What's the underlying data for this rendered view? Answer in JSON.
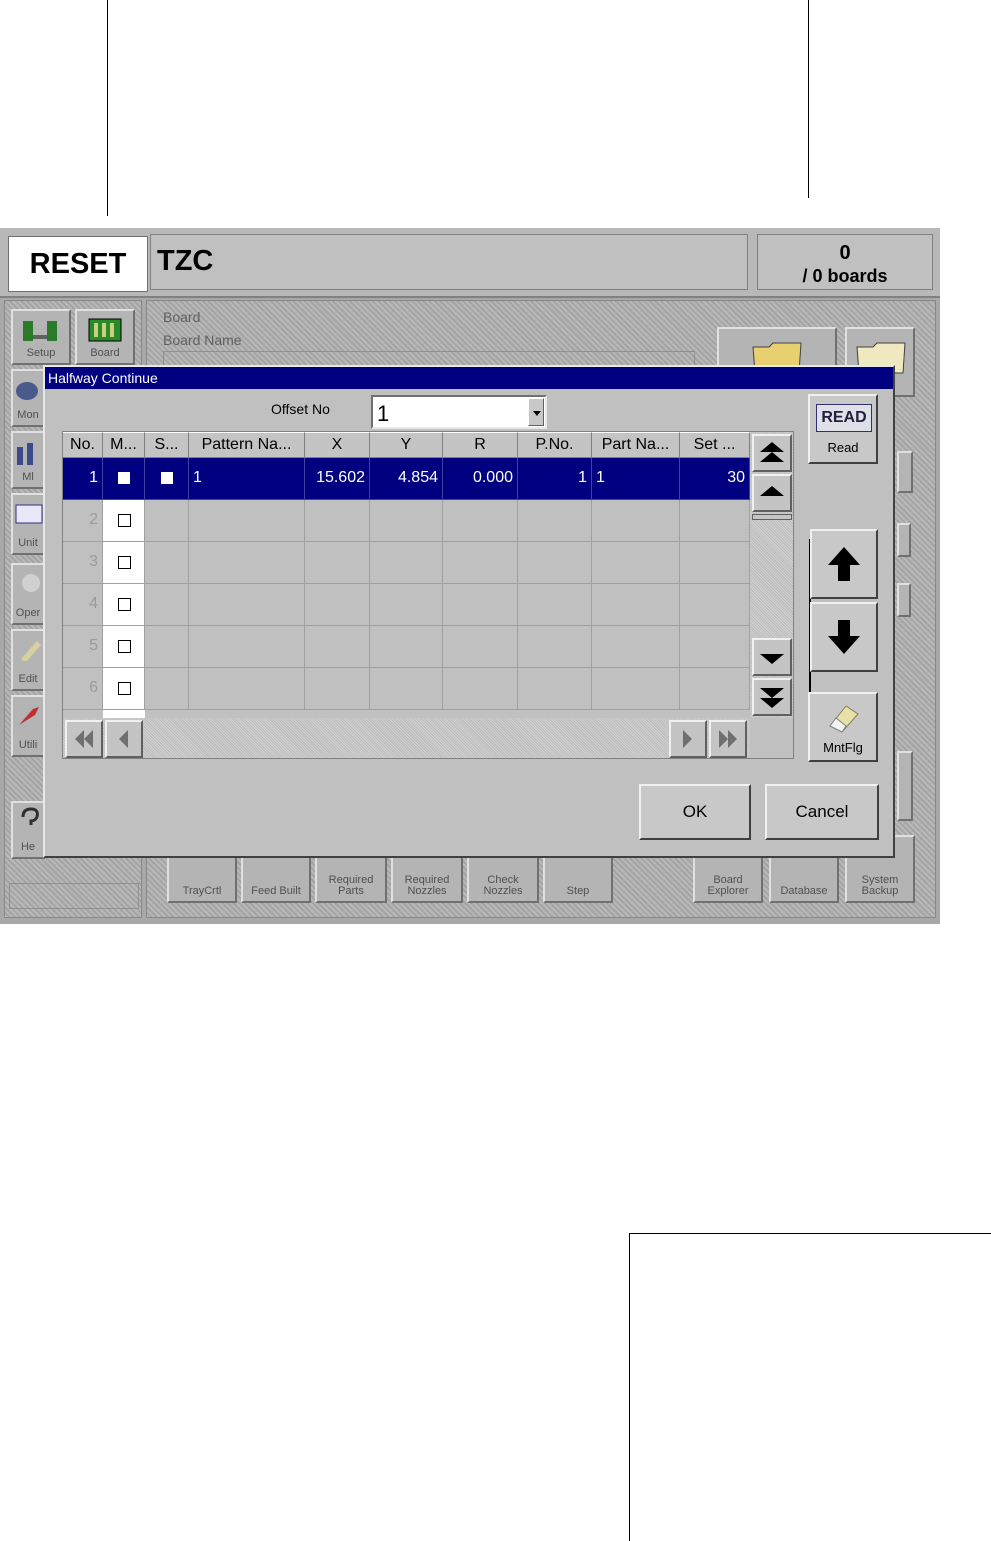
{
  "app": {
    "reset_label": "RESET",
    "title": "TZC",
    "count": "0",
    "boards_label": "/ 0 boards"
  },
  "background": {
    "left_buttons": [
      "Setup",
      "Board",
      "Mon",
      "Ml",
      "Unit",
      "Oper",
      "Edit",
      "Utili",
      "He"
    ],
    "board_group_label": "Board",
    "board_name_label": "Board Name",
    "bottom_buttons": [
      "TrayCrtl",
      "Feed Built",
      "Required Parts",
      "Required Nozzles",
      "Check Nozzles",
      "Step",
      "Board Explorer",
      "Database",
      "System Backup"
    ]
  },
  "dialog": {
    "title": "Halfway Continue",
    "offset_label": "Offset No",
    "offset_value": "1",
    "columns": [
      "No.",
      "M...",
      "S...",
      "Pattern Na...",
      "X",
      "Y",
      "R",
      "P.No.",
      "Part Na...",
      "Set ..."
    ],
    "rows": [
      {
        "no": "1",
        "m": true,
        "s": true,
        "pattern": "1",
        "x": "15.602",
        "y": "4.854",
        "r": "0.000",
        "pno": "1",
        "part": "1",
        "set": "30"
      },
      {
        "no": "2",
        "m": false,
        "s": null,
        "pattern": "",
        "x": "",
        "y": "",
        "r": "",
        "pno": "",
        "part": "",
        "set": ""
      },
      {
        "no": "3",
        "m": false,
        "s": null,
        "pattern": "",
        "x": "",
        "y": "",
        "r": "",
        "pno": "",
        "part": "",
        "set": ""
      },
      {
        "no": "4",
        "m": false,
        "s": null,
        "pattern": "",
        "x": "",
        "y": "",
        "r": "",
        "pno": "",
        "part": "",
        "set": ""
      },
      {
        "no": "5",
        "m": false,
        "s": null,
        "pattern": "",
        "x": "",
        "y": "",
        "r": "",
        "pno": "",
        "part": "",
        "set": ""
      },
      {
        "no": "6",
        "m": false,
        "s": null,
        "pattern": "",
        "x": "",
        "y": "",
        "r": "",
        "pno": "",
        "part": "",
        "set": ""
      }
    ],
    "read_icon_text": "READ",
    "read_label": "Read",
    "mntflg_label": "MntFlg",
    "ok_label": "OK",
    "cancel_label": "Cancel"
  }
}
